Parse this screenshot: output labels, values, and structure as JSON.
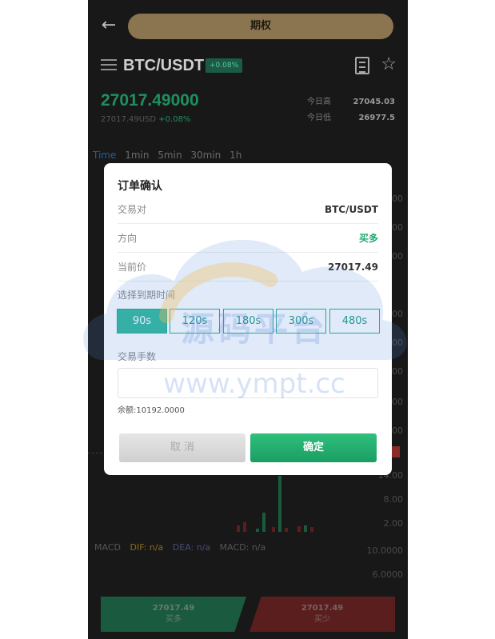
{
  "header": {
    "back_icon": "arrow-left-icon",
    "mode_title": "期权"
  },
  "pair_bar": {
    "menu_icon": "list-icon",
    "pair": "BTC/USDT",
    "change_badge": "+0.08%",
    "doc_icon": "clipboard-icon",
    "star_icon": "star-icon"
  },
  "ticker": {
    "price": "27017.49000",
    "sub_usd": "27017.49USD",
    "sub_change": "+0.08%",
    "high_label": "今日高",
    "high_value": "27045.03",
    "low_label": "今日低",
    "low_value": "26977.5"
  },
  "timeframes": [
    "Time",
    "1min",
    "5min",
    "30min",
    "1h"
  ],
  "axis_right": [
    "00",
    "00",
    "00",
    "00",
    "00",
    "00",
    "00",
    "00",
    "14.00",
    "8.00",
    "2.00",
    "10.0000",
    "6.0000"
  ],
  "indicators": {
    "macd": "MACD",
    "dif": "DIF: n/a",
    "dea": "DEA: n/a",
    "macd_val": "MACD: n/a"
  },
  "bottom": {
    "buy_price": "27017.49",
    "buy_label": "买多",
    "sell_price": "27017.49",
    "sell_label": "买少"
  },
  "modal": {
    "title": "订单确认",
    "rows": [
      {
        "label": "交易对",
        "value": "BTC/USDT"
      },
      {
        "label": "方向",
        "value": "买多"
      },
      {
        "label": "当前价",
        "value": "27017.49"
      }
    ],
    "expiry_label": "选择到期时间",
    "durations": [
      "90s",
      "120s",
      "180s",
      "300s",
      "480s"
    ],
    "selected_duration": "90s",
    "lots_label": "交易手数",
    "lots_value": "",
    "lots_placeholder": "",
    "balance": "余额:10192.0000",
    "cancel_label": "取 消",
    "confirm_label": "确定"
  },
  "watermark": {
    "text": "源码平台",
    "url": "www.ympt.cc"
  },
  "colors": {
    "green": "#1faa72",
    "teal": "#1a9b83",
    "background": "#181818"
  }
}
